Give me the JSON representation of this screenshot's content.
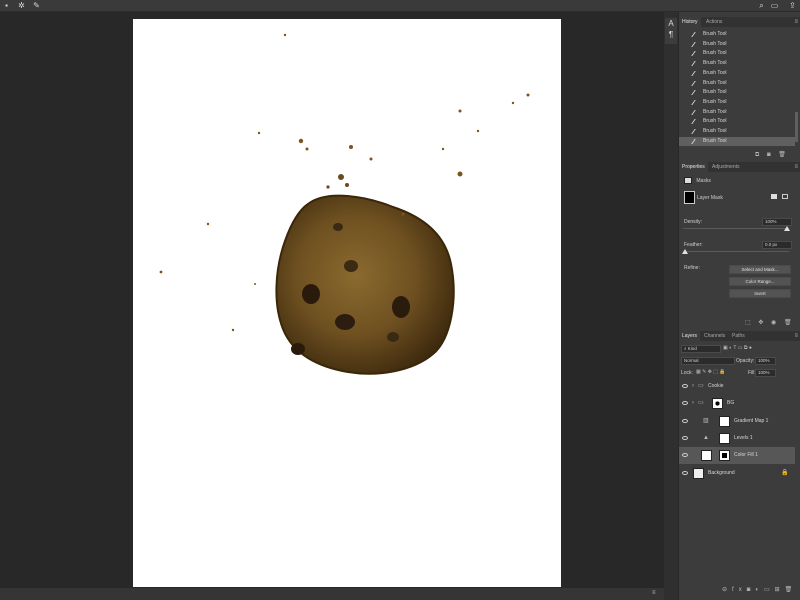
{
  "topbar": {
    "icons": [
      "home-icon",
      "gear-icon",
      "brush-options-icon",
      "search-icon",
      "workspace-icon",
      "share-icon"
    ]
  },
  "history": {
    "tabs": [
      "History",
      "Actions"
    ],
    "items": [
      "Brush Tool",
      "Brush Tool",
      "Brush Tool",
      "Brush Tool",
      "Brush Tool",
      "Brush Tool",
      "Brush Tool",
      "Brush Tool",
      "Brush Tool",
      "Brush Tool",
      "Brush Tool",
      "Brush Tool"
    ],
    "selected_index": 11
  },
  "properties": {
    "tabs": [
      "Properties",
      "Adjustments"
    ],
    "section": "Masks",
    "mask_label": "Layer Mask",
    "density_label": "Density:",
    "density_value": "100%",
    "feather_label": "Feather:",
    "feather_value": "0.0 px",
    "refine_label": "Refine:",
    "buttons": [
      "Select and Mask...",
      "Color Range...",
      "Invert"
    ]
  },
  "layers": {
    "tabs": [
      "Layers",
      "Channels",
      "Paths"
    ],
    "kind_label": "Kind",
    "blend_mode": "Normal",
    "opacity_label": "Opacity:",
    "opacity_value": "100%",
    "lock_label": "Lock:",
    "fill_label": "Fill:",
    "fill_value": "100%",
    "items": [
      {
        "name": "Cookie",
        "kind": "group"
      },
      {
        "name": "BG",
        "kind": "group-mask"
      },
      {
        "name": "Gradient Map 1",
        "kind": "adjust"
      },
      {
        "name": "Levels 1",
        "kind": "adjust"
      },
      {
        "name": "Color Fill 1",
        "kind": "fill",
        "selected": true
      },
      {
        "name": "Background",
        "kind": "background"
      }
    ]
  },
  "colors": {
    "panel": "#3c3c3c",
    "app_bg": "#282828",
    "document": "#ffffff",
    "cookie": "#6b4a1c",
    "selected_row": "#575757"
  }
}
